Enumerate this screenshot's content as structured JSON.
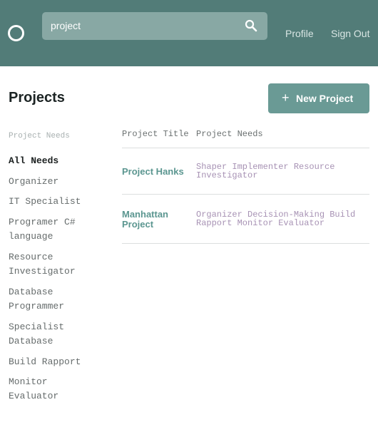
{
  "header": {
    "search": {
      "value": "project"
    },
    "nav": {
      "profile": "Profile",
      "sign_out": "Sign Out"
    }
  },
  "main": {
    "title": "Projects",
    "new_button_plus": "+",
    "new_button_label": "New Project"
  },
  "sidebar": {
    "heading": "Project Needs",
    "items": [
      {
        "label": "All Needs"
      },
      {
        "label": "Organizer"
      },
      {
        "label": "IT Specialist"
      },
      {
        "label": "Programer C# language"
      },
      {
        "label": "Resource Investigator"
      },
      {
        "label": "Database Programmer"
      },
      {
        "label": "Specialist Database"
      },
      {
        "label": "Build Rapport"
      },
      {
        "label": "Monitor Evaluator"
      }
    ]
  },
  "table": {
    "headers": [
      "Project Title",
      "Project Needs"
    ],
    "rows": [
      {
        "title": "Project Hanks",
        "needs": "Shaper Implementer Resource Investigator"
      },
      {
        "title": "Manhattan Project",
        "needs": "Organizer Decision-Making Build Rapport Monitor Evaluator"
      }
    ]
  },
  "colors": {
    "header": "#527c78",
    "accent": "#6a9a95",
    "project_link": "#5b9690",
    "needs_text": "#a792b4"
  }
}
